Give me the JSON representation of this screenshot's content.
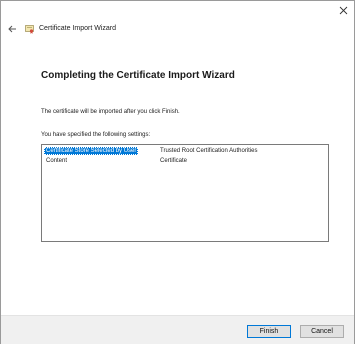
{
  "window": {
    "title": "Certificate Import Wizard"
  },
  "main": {
    "heading": "Completing the Certificate Import Wizard",
    "info_text": "The certificate will be imported after you click Finish.",
    "settings_label": "You have specified the following settings:",
    "settings": [
      {
        "name": "Certificate Store Selected by User",
        "value": "Trusted Root Certification Authorities",
        "selected": true
      },
      {
        "name": "Content",
        "value": "Certificate",
        "selected": false
      }
    ]
  },
  "footer": {
    "finish_label": "Finish",
    "cancel_label": "Cancel"
  },
  "icons": {
    "back": "back-arrow-icon",
    "app": "certificate-icon",
    "close": "close-icon"
  },
  "colors": {
    "selection": "#0078d7",
    "footer_bg": "#f0f0f0",
    "button_bg": "#e1e1e1"
  }
}
